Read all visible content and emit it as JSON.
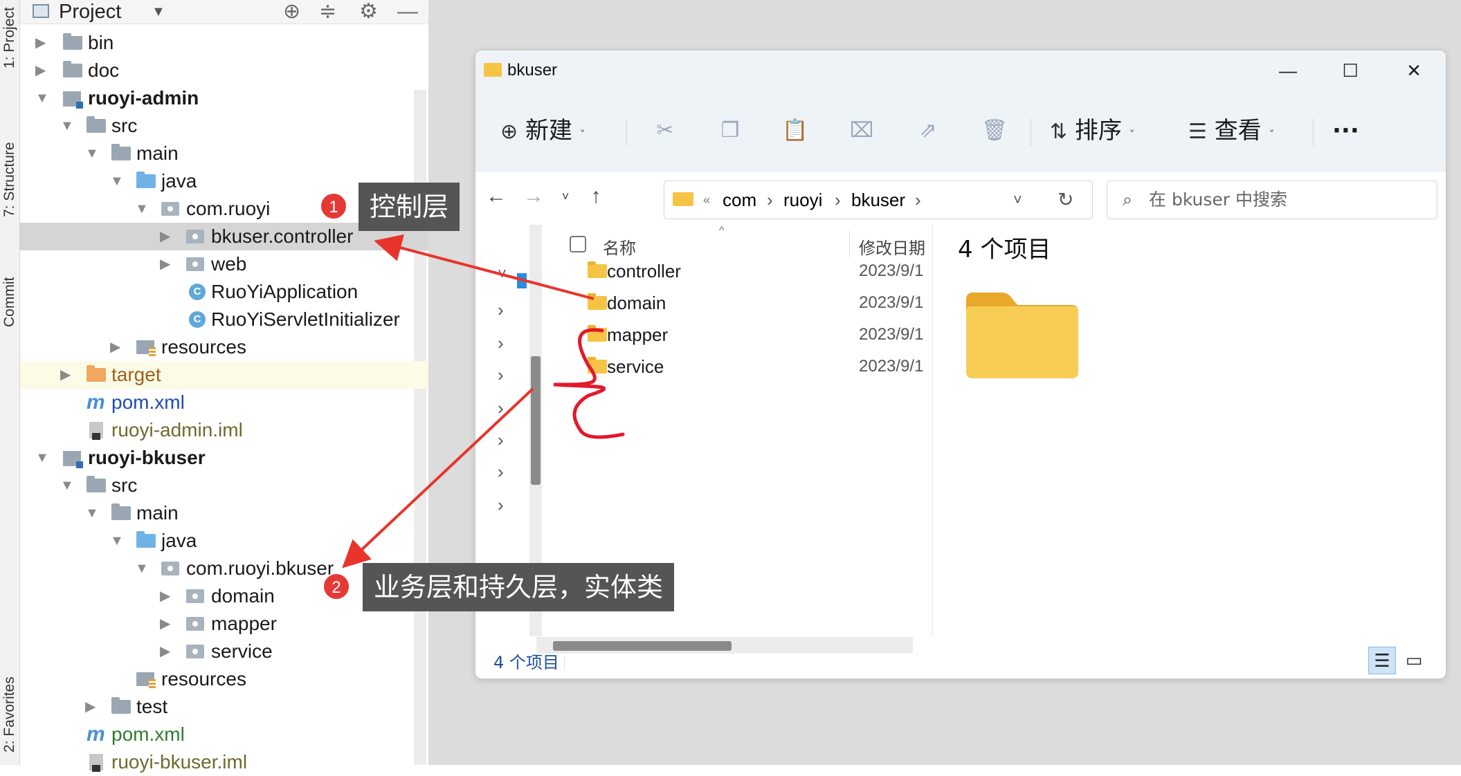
{
  "ide": {
    "side_tabs": {
      "project": "1: Project",
      "structure": "7: Structure",
      "commit": "Commit",
      "favorites": "2: Favorites"
    },
    "panel": {
      "title": "Project"
    },
    "tree": {
      "bin": "bin",
      "doc": "doc",
      "ruoyi_admin": "ruoyi-admin",
      "src1": "src",
      "main1": "main",
      "java1": "java",
      "com_ruoyi": "com.ruoyi",
      "bkuser_controller": "bkuser.controller",
      "web": "web",
      "ruoyi_application": "RuoYiApplication",
      "ruoyi_servlet": "RuoYiServletInitializer",
      "resources1": "resources",
      "target": "target",
      "pom1": "pom.xml",
      "admin_iml": "ruoyi-admin.iml",
      "ruoyi_bkuser": "ruoyi-bkuser",
      "src2": "src",
      "main2": "main",
      "java2": "java",
      "com_ruoyi_bkuser": "com.ruoyi.bkuser",
      "domain": "domain",
      "mapper": "mapper",
      "service": "service",
      "resources2": "resources",
      "test": "test",
      "pom2": "pom.xml",
      "bkuser_iml": "ruoyi-bkuser.iml"
    }
  },
  "callouts": {
    "one": {
      "num": "1",
      "text": "控制层"
    },
    "two": {
      "num": "2",
      "text": "业务层和持久层，实体类"
    }
  },
  "explorer": {
    "title": "bkuser",
    "cmd": {
      "new": "新建",
      "sort": "排序",
      "view": "查看",
      "more": "···"
    },
    "address": {
      "overflow": "«",
      "crumbs": [
        "com",
        "ruoyi",
        "bkuser"
      ]
    },
    "search_placeholder": "在 bkuser 中搜索",
    "columns": {
      "name": "名称",
      "modified": "修改日期"
    },
    "items": [
      {
        "name": "controller",
        "date": "2023/9/1"
      },
      {
        "name": "domain",
        "date": "2023/9/1"
      },
      {
        "name": "mapper",
        "date": "2023/9/1"
      },
      {
        "name": "service",
        "date": "2023/9/1"
      }
    ],
    "details_count": "4 个项目",
    "status": "4 个项目"
  },
  "colors": {
    "arrow": "#e8342b",
    "scribble": "#e3182a",
    "badge": "#e53935",
    "callout_bg": "#555555"
  }
}
